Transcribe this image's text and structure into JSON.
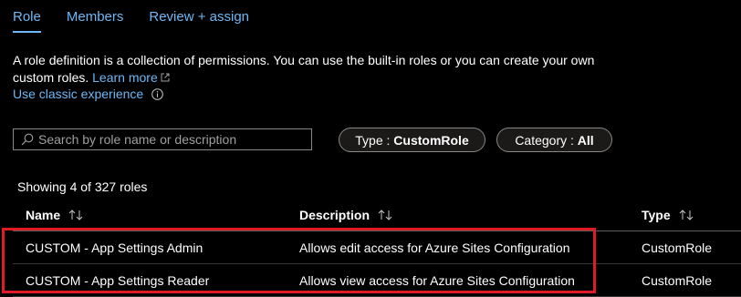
{
  "tabs": [
    {
      "label": "Role"
    },
    {
      "label": "Members"
    },
    {
      "label": "Review + assign"
    }
  ],
  "description": {
    "text": "A role definition is a collection of permissions. You can use the built-in roles or you can create your own custom roles.",
    "learn_more": "Learn more"
  },
  "classic_link": "Use classic experience",
  "search": {
    "placeholder": "Search by role name or description"
  },
  "filters": {
    "type": {
      "label": "Type :",
      "value": "CustomRole"
    },
    "category": {
      "label": "Category :",
      "value": "All"
    }
  },
  "count_text": "Showing 4 of 327 roles",
  "table": {
    "columns": [
      "Name",
      "Description",
      "Type"
    ],
    "rows": [
      {
        "name": "CUSTOM - App Settings Admin",
        "description": "Allows edit access for Azure Sites Configuration",
        "type": "CustomRole"
      },
      {
        "name": "CUSTOM - App Settings Reader",
        "description": "Allows view access for Azure Sites Configuration",
        "type": "CustomRole"
      }
    ]
  },
  "colors": {
    "link": "#6cb8f6",
    "highlight": "#e01b24",
    "background": "#000000"
  }
}
